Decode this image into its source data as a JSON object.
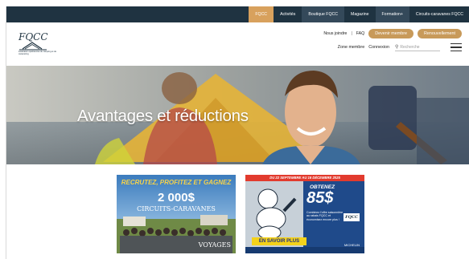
{
  "topnav": {
    "tabs": [
      {
        "label": "FQCC",
        "state": "active"
      },
      {
        "label": "Activités",
        "state": "normal"
      },
      {
        "label": "Boutique FQCC",
        "state": "dark"
      },
      {
        "label": "Magazine",
        "state": "normal"
      },
      {
        "label": "Formation+",
        "state": "dark"
      },
      {
        "label": "Circuits-caravanes FQCC",
        "state": "normal"
      }
    ]
  },
  "logo": {
    "wordmark": "FQCC",
    "caption": "Fédération québécoise du camping et de caravaning"
  },
  "header": {
    "join_link": "Nous joindre",
    "separator": "|",
    "faq_link": "FAQ",
    "become_member_button": "Devenir membre",
    "renewal_button": "Renouvellement",
    "member_zone_link": "Zone membre",
    "login_link": "Connexion",
    "search_placeholder": "Recherche",
    "search_icon": "search-icon",
    "menu_icon": "hamburger-icon"
  },
  "hero": {
    "title": "Avantages et réductions"
  },
  "promos": [
    {
      "line1": "RECRUTEZ, PROFITEZ ET GAGNEZ",
      "line2": "2 000$",
      "line3": "CIRCUITS-CARAVANES",
      "line4": "VOYAGES"
    },
    {
      "top_banner": "DU 22 SEPTEMBRE AU 16 DÉCEMBRE 2025",
      "obtain": "OBTENEZ",
      "amount": "85$",
      "text": "Combinez l'offre saisonnière au rabais FQCC et économisez encore plus !",
      "brand": "FQCC",
      "cta": "EN SAVOIR PLUS",
      "footer": "MICHELIN"
    }
  ],
  "colors": {
    "topbar": "#1f3341",
    "accent_gold": "#c89a5a",
    "promo2_bg": "#1f4a8a",
    "promo_cta": "#f4d21a"
  }
}
